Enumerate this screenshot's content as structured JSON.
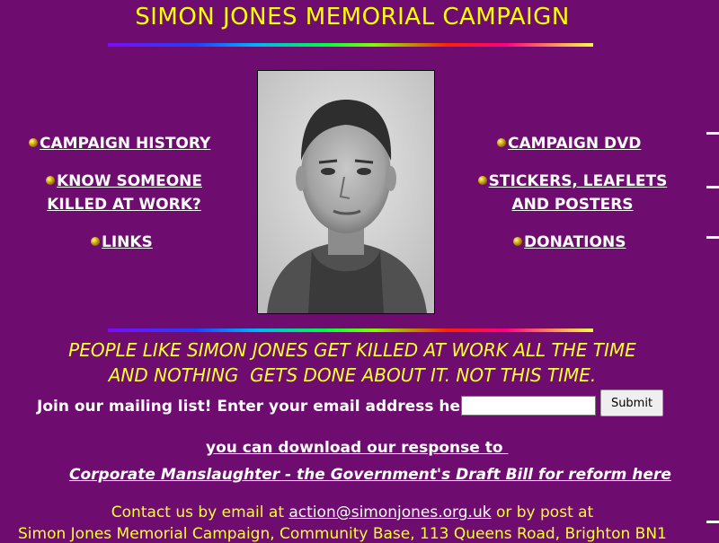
{
  "header": {
    "title": "SIMON JONES MEMORIAL CAMPAIGN"
  },
  "nav_left": [
    {
      "label": "CAMPAIGN HISTORY"
    },
    {
      "label_line1": "KNOW SOMEONE",
      "label_line2": "KILLED AT WORK?"
    },
    {
      "label": "LINKS"
    }
  ],
  "nav_right": [
    {
      "label": "CAMPAIGN DVD"
    },
    {
      "label_line1": "STICKERS, LEAFLETS",
      "label_line2": "AND POSTERS"
    },
    {
      "label": "DONATIONS"
    }
  ],
  "slogan": {
    "line1": "PEOPLE LIKE SIMON JONES GET KILLED AT WORK ALL THE TIME",
    "line2": "AND NOTHING  GETS DONE ABOUT IT. NOT THIS TIME."
  },
  "mailing": {
    "label": "Join our mailing list! Enter your email address here",
    "input_value": "",
    "submit_label": "Submit"
  },
  "download": {
    "line1": "you can download our response to ",
    "line2_link": "Corporate Manslaughter - the Government's Draft Bill for reform",
    "line2_here": " here"
  },
  "contact": {
    "prefix": "Contact us by email at ",
    "email": "action@simonjones.org.uk",
    "suffix": " or by post at",
    "address": "Simon Jones Memorial Campaign, Community Base, 113 Queens Road, Brighton BN1"
  },
  "colors": {
    "background": "#6e0c6f",
    "title": "#ffff00",
    "links": "#ffffff",
    "slogan": "#ffff33"
  }
}
